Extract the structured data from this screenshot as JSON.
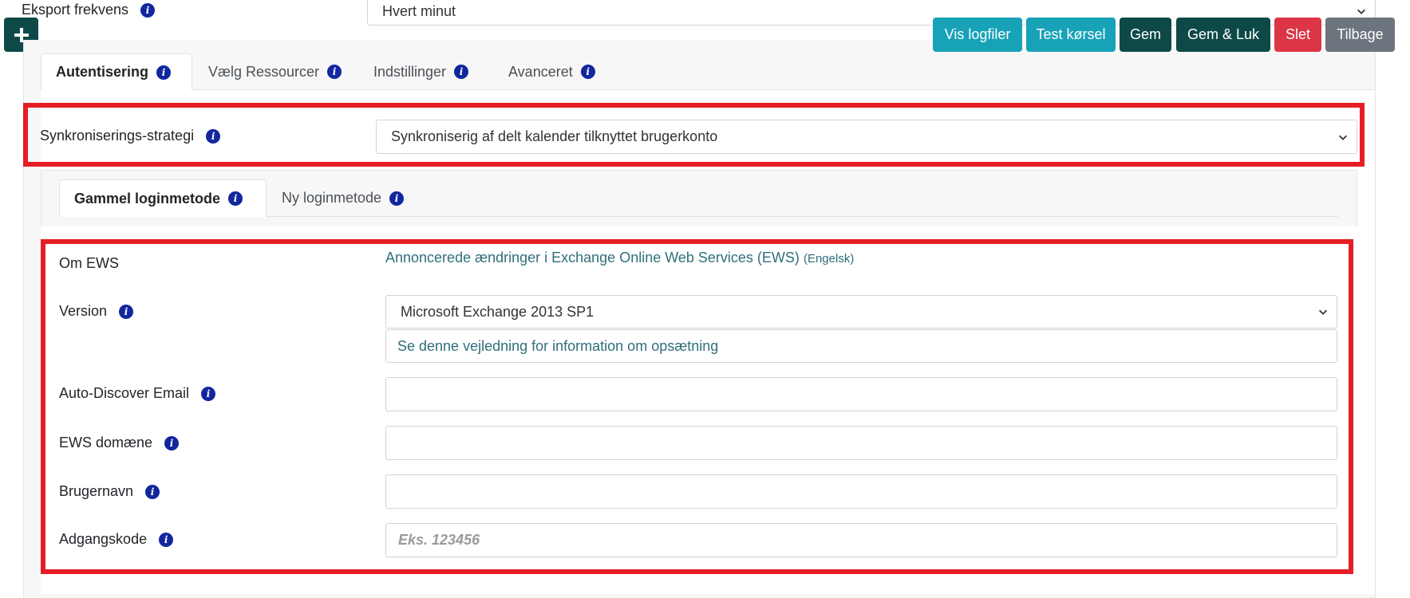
{
  "export_row": {
    "label": "Eksport frekvens",
    "value": "Hvert minut"
  },
  "toolbar": {
    "add_label": "+",
    "vis_logfiler": "Vis logfiler",
    "test_korsel": "Test kørsel",
    "gem": "Gem",
    "gem_luk": "Gem & Luk",
    "slet": "Slet",
    "tilbage": "Tilbage"
  },
  "tabs": [
    {
      "label": "Autentisering"
    },
    {
      "label": "Vælg Ressourcer"
    },
    {
      "label": "Indstillinger"
    },
    {
      "label": "Avanceret"
    }
  ],
  "strategy": {
    "label": "Synkroniserings-strategi",
    "value": "Synkroniserig af delt kalender tilknyttet brugerkonto"
  },
  "subtabs": [
    {
      "label": "Gammel loginmetode"
    },
    {
      "label": "Ny loginmetode"
    }
  ],
  "ews": {
    "about_label": "Om EWS",
    "about_link": "Annoncerede ændringer i Exchange Online Web Services (EWS)",
    "about_lang": "(Engelsk)",
    "version_label": "Version",
    "version_value": "Microsoft Exchange 2013 SP1",
    "version_help": "Se denne vejledning for information om opsætning",
    "autodiscover_label": "Auto-Discover Email",
    "domain_label": "EWS domæne",
    "username_label": "Brugernavn",
    "password_label": "Adgangskode",
    "password_placeholder": "Eks. 123456"
  },
  "colors": {
    "info": "#12279e",
    "teal": "#17a2b8",
    "dark_green": "#0d4a47",
    "red": "#dc3545",
    "gray": "#6c757d",
    "highlight": "#e51e25"
  },
  "icons": {
    "info": "info-circle-icon",
    "chevron": "chevron-down-icon",
    "plus": "plus-icon"
  }
}
